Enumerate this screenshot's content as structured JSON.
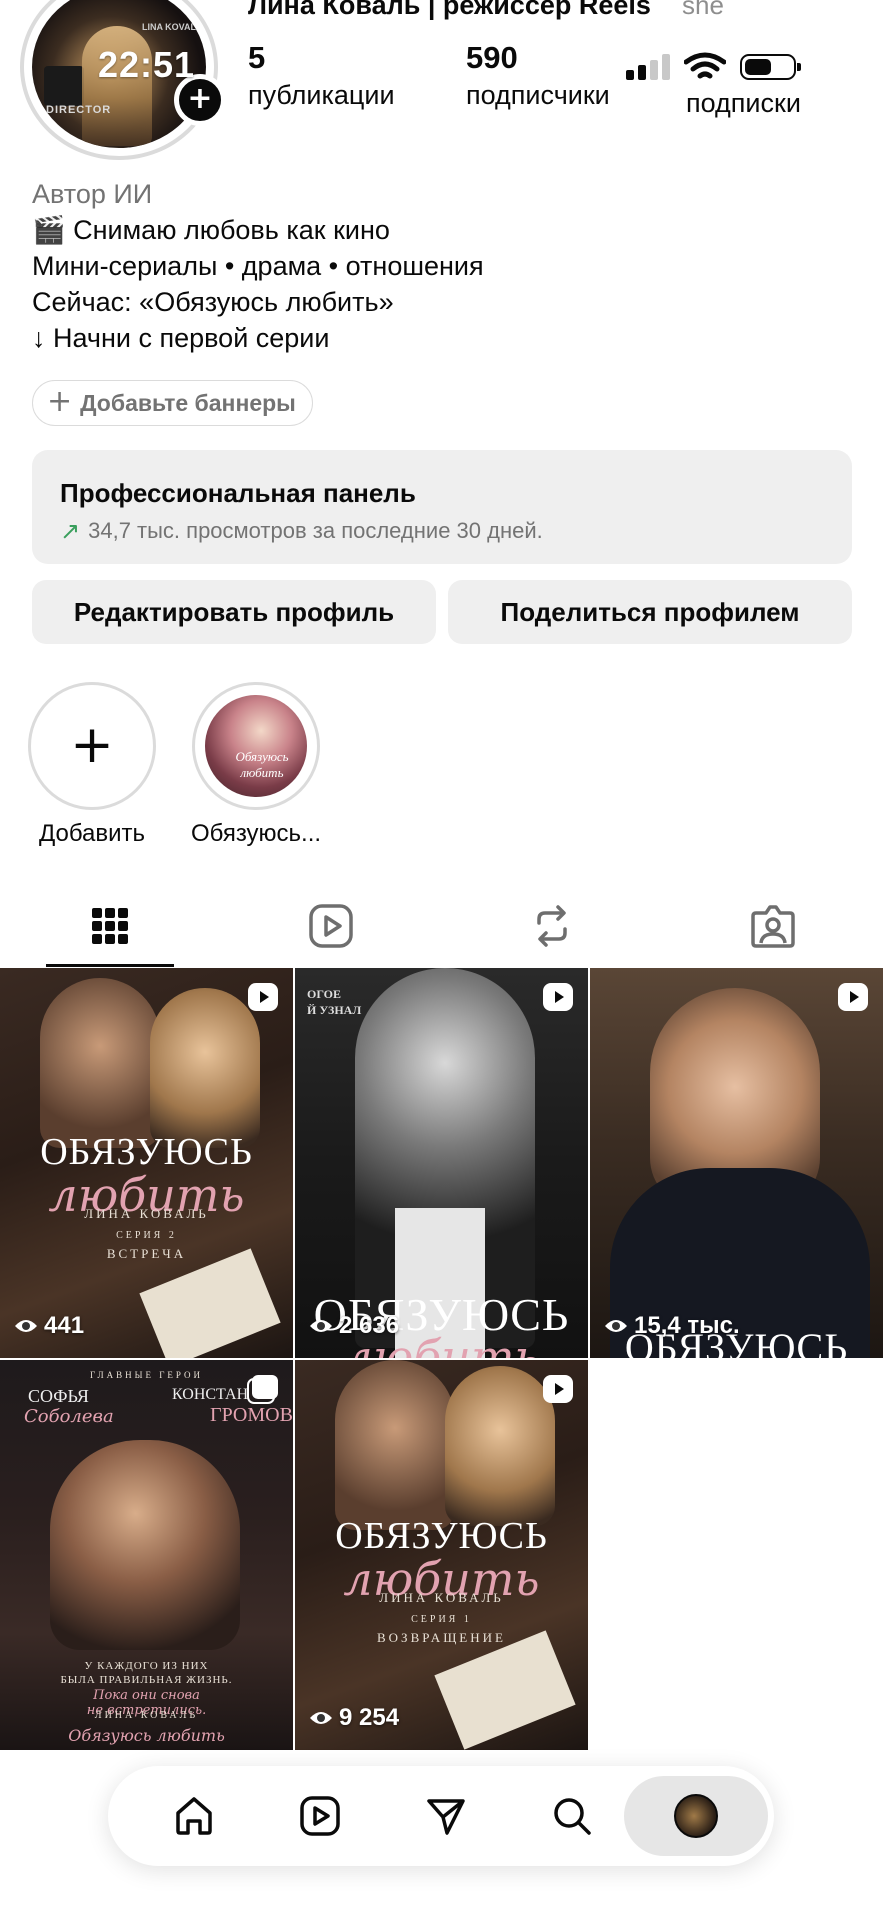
{
  "status_bar": {
    "time": "22:51"
  },
  "profile": {
    "name": "Лина Коваль | режиссер Reels",
    "pronoun": "she",
    "story_add_symbol": "+",
    "stats": {
      "posts": {
        "value": "5",
        "label": "публикации"
      },
      "followers": {
        "value": "590",
        "label": "подписчики"
      },
      "following": {
        "label": "подписки"
      }
    },
    "avatar_text": "DIRECTOR",
    "avatar_badge": "LINA KOVAL"
  },
  "bio": {
    "category": "Автор ИИ",
    "lines": [
      "🎬 Снимаю любовь как кино",
      "Мини-сериалы • драма • отношения",
      "Сейчас: «Обязуюсь любить»",
      "↓ Начни с первой серии"
    ]
  },
  "banner_button": {
    "plus": "+",
    "label": "Добавьте баннеры"
  },
  "pro_panel": {
    "title": "Профессиональная панель",
    "arrow": "↗",
    "subtitle": "34,7 тыс. просмотров за последние 30 дней."
  },
  "buttons": {
    "edit": "Редактировать профиль",
    "share": "Поделиться профилем"
  },
  "highlights": [
    {
      "name": "Добавить",
      "symbol": "+"
    },
    {
      "name": "Обязуюсь...",
      "cover_text": "Обязуюсь любить"
    }
  ],
  "tabs": [
    "grid-icon",
    "reels-icon",
    "reposts-icon",
    "tagged-icon"
  ],
  "posts": [
    {
      "views": "441",
      "title": "ОБЯЗУЮСЬ",
      "script": "любить",
      "author": "ЛИНА КОВАЛЬ",
      "series": "СЕРИЯ 2",
      "episode": "ВСТРЕЧА"
    },
    {
      "views": "2 636",
      "title": "ОБЯЗУЮСЬ",
      "script": "любить",
      "top_text": "ОГОЕ\nЙ УЗНАЛ"
    },
    {
      "views": "15,4 тыс.",
      "title": "ОБЯЗУЮСЬ"
    },
    {
      "left_name": "СОФЬЯ",
      "left_surname": "Соболева",
      "right_name": "КОНСТАН",
      "right_surname": "ГРОМОВ",
      "header": "ГЛАВНЫЕ ГЕРОИ",
      "tagline1": "У КАЖДОГО ИЗ НИХ",
      "tagline2": "БЫЛА ПРАВИЛЬНАЯ ЖИЗНЬ.",
      "tagline3": "Пока они снова",
      "tagline4": "не встретились.",
      "author": "ЛИНА КОВАЛЬ",
      "footer_script": "Обязуюсь любить"
    },
    {
      "views": "9 254",
      "title": "ОБЯЗУЮСЬ",
      "script": "любить",
      "author": "ЛИНА КОВАЛЬ",
      "series": "СЕРИЯ 1",
      "episode": "ВОЗВРАЩЕНИЕ"
    }
  ],
  "bottom_nav": [
    "home-icon",
    "reels-icon",
    "direct-icon",
    "search-icon",
    "profile-avatar"
  ],
  "colors": {
    "accent_pink": "#e2a2b0",
    "green_arrow": "#3a9f5d",
    "secondary_text": "#737373",
    "panel_bg": "#efefef"
  }
}
